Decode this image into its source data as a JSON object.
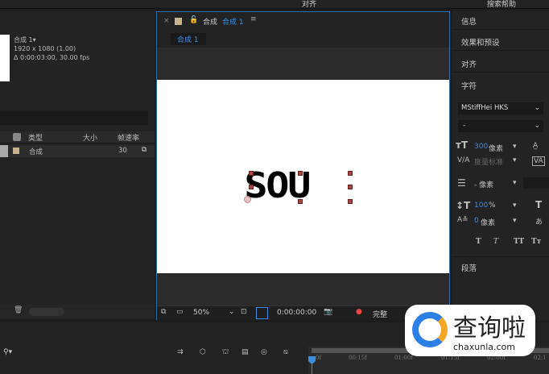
{
  "toolbar": {
    "align_label": "对齐",
    "search_help": "搜索帮助"
  },
  "project": {
    "comp_name": "合成 1▾",
    "resolution": "1920 x 1080 (1.00)",
    "duration": "Δ 0:00:03:00, 30.00 fps",
    "columns": [
      "类型",
      "大小",
      "帧速率"
    ],
    "rows": [
      {
        "type": "合成",
        "fps": "30"
      }
    ]
  },
  "comp_panel": {
    "tab_prefix": "合成",
    "tab_name": "合成 1",
    "breadcrumb": "合成 1",
    "canvas_text": "SOU",
    "zoom": "50%",
    "timecode": "0:00:00:00",
    "quality": "完整"
  },
  "right_panel": {
    "sections": [
      "信息",
      "效果和预设",
      "对齐",
      "字符"
    ],
    "font": "MStiffHei HKS",
    "style": "-",
    "font_size": "300",
    "font_size_unit": "像素",
    "tracking_label": "度量标准",
    "leading": "- 像素",
    "vscale": "100",
    "vscale_unit": "%",
    "baseline": "0",
    "baseline_unit": "像素",
    "style_buttons": [
      "T",
      "T",
      "TT",
      "Tт"
    ],
    "paragraph": "段落"
  },
  "timeline": {
    "ticks": [
      "0f",
      "00:15f",
      "01:00f",
      "01:15f",
      "02:00f",
      "02:1"
    ]
  },
  "watermark": {
    "brand": "查询啦",
    "url": "chaxunla.com"
  },
  "colors": {
    "accent": "#3c8de0",
    "panel": "#232323",
    "handle": "#a84545"
  }
}
